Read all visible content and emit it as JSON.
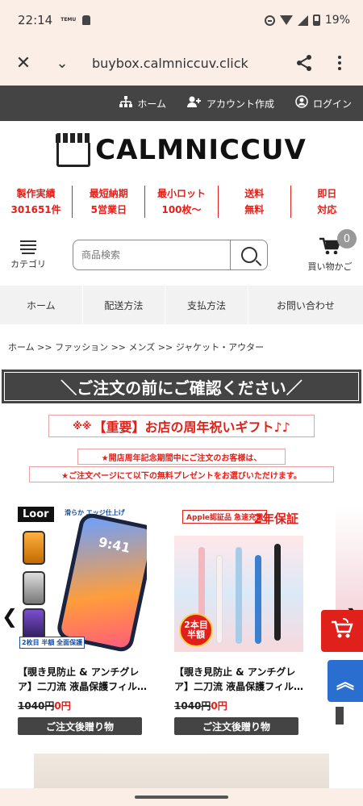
{
  "status": {
    "time": "22:14",
    "temu": "TEMU",
    "battery": "19%"
  },
  "browser": {
    "url": "buybox.calmniccuv.click"
  },
  "topnav": {
    "home": "ホーム",
    "account": "アカウント作成",
    "login": "ログイン"
  },
  "logo": {
    "name": "CALMNICCUV"
  },
  "features": [
    {
      "line1": "製作実績",
      "line2": "301651件"
    },
    {
      "line1": "最短納期",
      "line2": "5営業日"
    },
    {
      "line1": "最小ロット",
      "line2": "100枚〜"
    },
    {
      "line1": "送料",
      "line2": "無料"
    },
    {
      "line1": "即日",
      "line2": "対応"
    }
  ],
  "search": {
    "category_label": "カテゴリ",
    "placeholder": "商品検索",
    "cart_label": "買い物かご",
    "cart_count": "0"
  },
  "menu": {
    "home": "ホーム",
    "shipping": "配送方法",
    "payment": "支払方法",
    "contact": "お問い合わせ"
  },
  "breadcrumb": "ホーム >> ファッション >> メンズ >> ジャケット・アウター",
  "notice": "＼ご注文の前にご確認ください／",
  "gift": {
    "stars": "※※",
    "text": "【重要】お店の周年祝いギフト♪♪"
  },
  "message1": "★開店周年記念期間中にご注文のお客様は、",
  "message2": "★ご注文ページにて以下の無料プレゼントをお選びいただけます。",
  "products": [
    {
      "title": "【覗き見防止 & アンチグレア】二刀流 液晶保護フィル…",
      "old_price": "1040円",
      "new_price": "0円",
      "button": "ご注文後贈り物",
      "brand": "Loor",
      "tag": "2枚目 半額 全面保護",
      "badge": "滑らか エッジ仕上げ",
      "screen_time": "9:41"
    },
    {
      "title": "【覗き見防止 & アンチグレア】二刀流 液晶保護フィル…",
      "old_price": "1040円",
      "new_price": "0円",
      "button": "ご注文後贈り物",
      "apple": "Apple認証品 急速充電",
      "warranty": "2年保証",
      "half": "2本目 半額"
    }
  ]
}
